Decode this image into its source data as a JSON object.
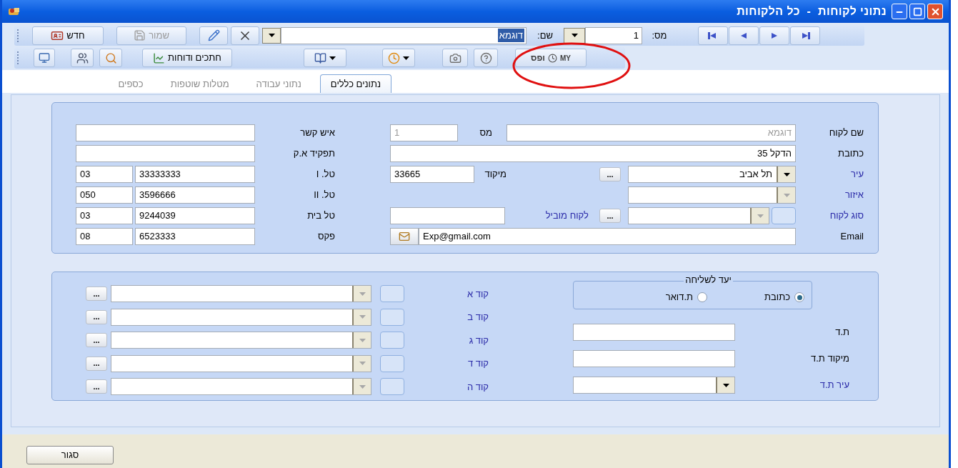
{
  "window": {
    "title": "נתוני לקוחות  -  כל הלקוחות"
  },
  "toolbar": {
    "new_button": "חדש",
    "save_button": {
      "label": "שמור",
      "disabled": true
    },
    "name_label": "שם:",
    "name_value": "דוגמא",
    "number_label": "מס:",
    "number_value": "1",
    "reports_button": "חתכים ודוחות",
    "logo": {
      "brand": "MY",
      "word": "ופס"
    }
  },
  "tabs": [
    {
      "label": "נתונים כללים",
      "selected": true
    },
    {
      "label": "נתוני עבודה",
      "selected": false
    },
    {
      "label": "מטלות שוטפות",
      "selected": false
    },
    {
      "label": "כספים",
      "selected": false
    }
  ],
  "customer": {
    "name": {
      "label": "שם לקוח",
      "value": "דוגמא",
      "disabled": true
    },
    "number": {
      "label": "מס",
      "value": "1",
      "disabled": true
    },
    "address": {
      "label": "כתובת",
      "value": "הדקל 35"
    },
    "city": {
      "label": "עיר",
      "value": "תל אביב",
      "linked": true,
      "disabled": false,
      "browse": "..."
    },
    "zip": {
      "label": "מיקוד",
      "value": "33665"
    },
    "region": {
      "label": "איזור",
      "linked": true,
      "disabled": true
    },
    "type": {
      "label": "סוג לקוח",
      "linked": true,
      "disabled": true,
      "browse": "..."
    },
    "lead_customer": {
      "label": "לקוח מוביל",
      "linked": true
    },
    "email": {
      "label": "Email",
      "value": "Exp@gmail.com"
    }
  },
  "contacts": [
    {
      "kind": "text",
      "label": "איש קשר"
    },
    {
      "kind": "text",
      "label": "תפקיד א.ק"
    },
    {
      "kind": "phone",
      "label": "טל. I",
      "area": "03",
      "number": "33333333"
    },
    {
      "kind": "phone",
      "label": "טל. II",
      "area": "050",
      "number": "3596666"
    },
    {
      "kind": "phone",
      "label": "טל בית",
      "area": "03",
      "number": "9244039"
    },
    {
      "kind": "phone",
      "label": "פקס",
      "area": "08",
      "number": "6523333"
    }
  ],
  "delivery": {
    "title": "יעד לשליחה",
    "options": [
      {
        "label": "כתובת",
        "selected": true
      },
      {
        "label": "ת.דואר",
        "selected": false
      }
    ]
  },
  "po_box": [
    {
      "kind": "text",
      "label": "ת.ד",
      "linked": false
    },
    {
      "kind": "text",
      "label": "מיקוד ת.ד",
      "linked": false
    },
    {
      "kind": "combo",
      "label": "עיר ת.ד",
      "linked": true,
      "disabled": false
    }
  ],
  "codes": [
    {
      "label": "קוד א",
      "linked": true,
      "disabled": true,
      "browse": "..."
    },
    {
      "label": "קוד ב",
      "linked": true,
      "disabled": true,
      "browse": "..."
    },
    {
      "label": "קוד ג",
      "linked": true,
      "disabled": true,
      "browse": "..."
    },
    {
      "label": "קוד ד",
      "linked": true,
      "disabled": true,
      "browse": "..."
    },
    {
      "label": "קוד ה",
      "linked": true,
      "disabled": true,
      "browse": "..."
    }
  ],
  "close_button": "סגור"
}
